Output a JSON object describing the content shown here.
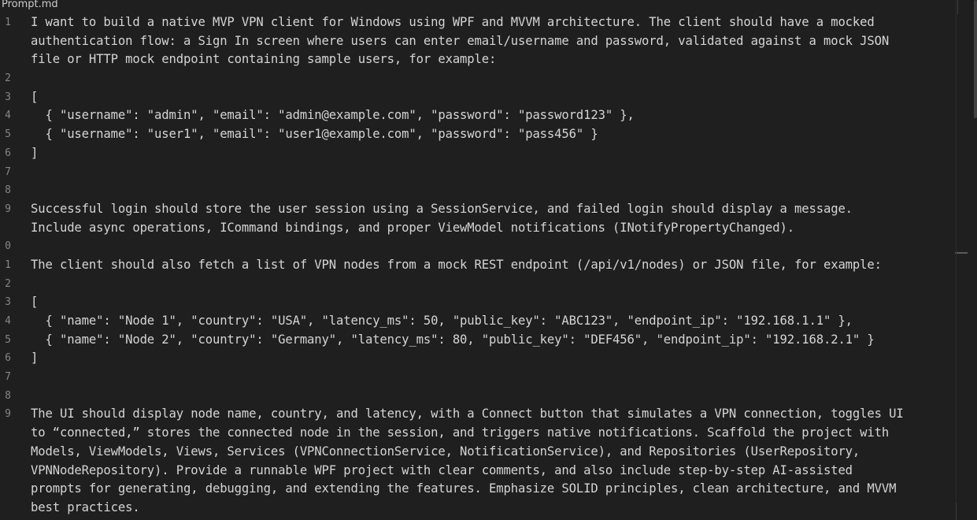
{
  "editor": {
    "file_name": "Prompt.md",
    "line_numbers": [
      "1",
      "2",
      "3",
      "4",
      "5",
      "6",
      "7",
      "8",
      "9",
      "0",
      "1",
      "2",
      "3",
      "4",
      "5",
      "6",
      "7",
      "8",
      "9"
    ],
    "lines": [
      "I want to build a native MVP VPN client for Windows using WPF and MVVM architecture. The client should have a mocked",
      "authentication flow: a Sign In screen where users can enter email/username and password, validated against a mock JSON",
      "file or HTTP mock endpoint containing sample users, for example:",
      "",
      "[",
      "  { \"username\": \"admin\", \"email\": \"admin@example.com\", \"password\": \"password123\" },",
      "  { \"username\": \"user1\", \"email\": \"user1@example.com\", \"password\": \"pass456\" }",
      "]",
      "",
      "",
      "Successful login should store the user session using a SessionService, and failed login should display a message.",
      "Include async operations, ICommand bindings, and proper ViewModel notifications (INotifyPropertyChanged).",
      "",
      "The client should also fetch a list of VPN nodes from a mock REST endpoint (/api/v1/nodes) or JSON file, for example:",
      "",
      "[",
      "  { \"name\": \"Node 1\", \"country\": \"USA\", \"latency_ms\": 50, \"public_key\": \"ABC123\", \"endpoint_ip\": \"192.168.1.1\" },",
      "  { \"name\": \"Node 2\", \"country\": \"Germany\", \"latency_ms\": 80, \"public_key\": \"DEF456\", \"endpoint_ip\": \"192.168.2.1\" }",
      "]",
      "",
      "",
      "The UI should display node name, country, and latency, with a Connect button that simulates a VPN connection, toggles UI",
      "to “connected,” stores the connected node in the session, and triggers native notifications. Scaffold the project with",
      "Models, ViewModels, Views, Services (VPNConnectionService, NotificationService), and Repositories (UserRepository,",
      "VPNNodeRepository). Provide a runnable WPF project with clear comments, and also include step-by-step AI-assisted",
      "prompts for generating, debugging, and extending the features. Emphasize SOLID principles, clean architecture, and MVVM",
      "best practices."
    ],
    "gutter": [
      "1",
      "",
      "",
      "2",
      "3",
      "4",
      "5",
      "6",
      "7",
      "8",
      "9",
      "",
      "0",
      "1",
      "2",
      "3",
      "4",
      "5",
      "6",
      "7",
      "8",
      "9",
      "",
      "",
      "",
      "",
      ""
    ]
  }
}
